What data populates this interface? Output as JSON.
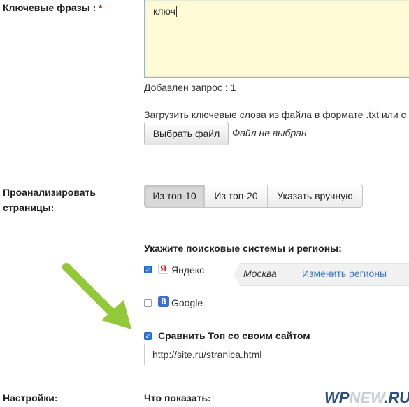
{
  "keywords": {
    "label": "Ключевые фразы :",
    "required_mark": "*",
    "value": "ключ",
    "added_status": "Добавлен запрос : 1"
  },
  "upload": {
    "hint": "Загрузить ключевые слова из файла в формате .txt или с",
    "button_label": "Выбрать файл",
    "status": "Файл не выбран"
  },
  "analyze": {
    "label_line1": "Проанализировать",
    "label_line2": "страницы:",
    "options": [
      "Из топ-10",
      "Из топ-20",
      "Указать вручную"
    ],
    "selected": "Из топ-10"
  },
  "engines": {
    "heading": "Укажите поисковые системы и регионы:",
    "yandex": {
      "label": "Яндекс",
      "checked": true,
      "icon": "yandex-icon",
      "icon_glyph": "Я"
    },
    "google": {
      "label": "Google",
      "checked": false,
      "icon": "google-icon",
      "icon_glyph": "8"
    },
    "region_name": "Москва",
    "change_regions_link": "Изменить регионы"
  },
  "compare": {
    "label": "Сравнить Топ со своим сайтом",
    "checked": true,
    "url_value": "http://site.ru/stranica.html"
  },
  "settings": {
    "label": "Настройки:",
    "show_label": "Что показать:"
  },
  "watermark": {
    "part1": "WP",
    "part2": "NEW",
    "part3": ".RU"
  },
  "colors": {
    "accent": "#2b7de1",
    "link": "#3a78c3",
    "arrow": "#93c83a",
    "textarea_bg": "#fefbd6"
  }
}
